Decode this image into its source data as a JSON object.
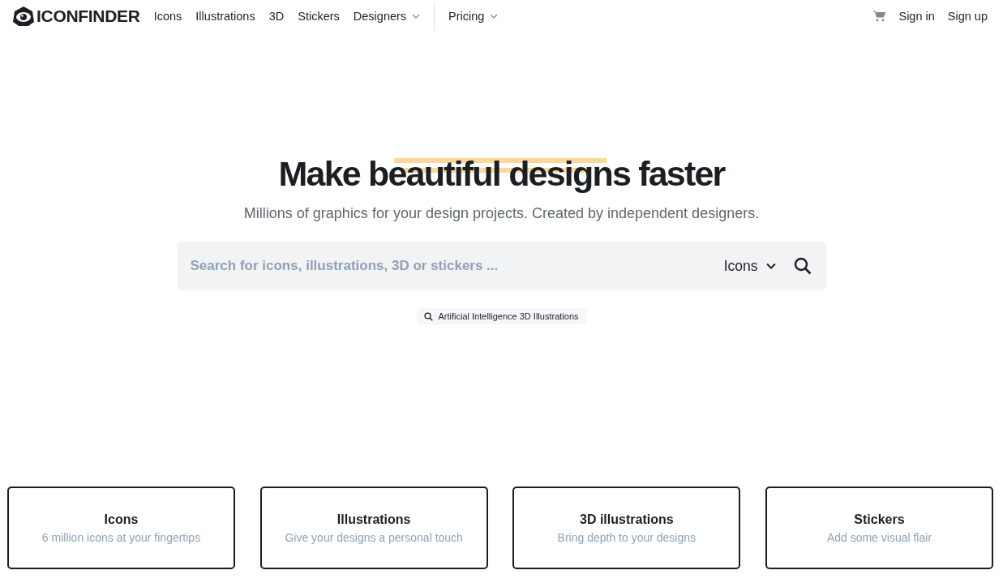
{
  "nav": {
    "logo": "ICONFINDER",
    "items": [
      {
        "label": "Icons",
        "kind": "link"
      },
      {
        "label": "Illustrations",
        "kind": "link"
      },
      {
        "label": "3D",
        "kind": "link"
      },
      {
        "label": "Stickers",
        "kind": "link"
      },
      {
        "label": "Designers",
        "kind": "dropdown"
      },
      {
        "label": "Pricing",
        "kind": "dropdown",
        "divided": true
      }
    ],
    "actions": [
      "Sign in",
      "Sign up"
    ]
  },
  "hero": {
    "title": "Make beautiful designs faster",
    "subtitle": "Millions of graphics for your design projects. Created by independent designers.",
    "search": {
      "placeholder": "Search for icons, illustrations, 3D or stickers ...",
      "type": "Icons"
    },
    "suggestion": "Artificial Intelligence 3D Illustrations"
  },
  "cards": [
    {
      "title": "Icons",
      "subtitle": "6 million icons at your fingertips"
    },
    {
      "title": "Illustrations",
      "subtitle": "Give your designs a personal touch"
    },
    {
      "title": "3D illustrations",
      "subtitle": "Bring depth to your designs"
    },
    {
      "title": "Stickers",
      "subtitle": "Add some visual flair"
    }
  ]
}
